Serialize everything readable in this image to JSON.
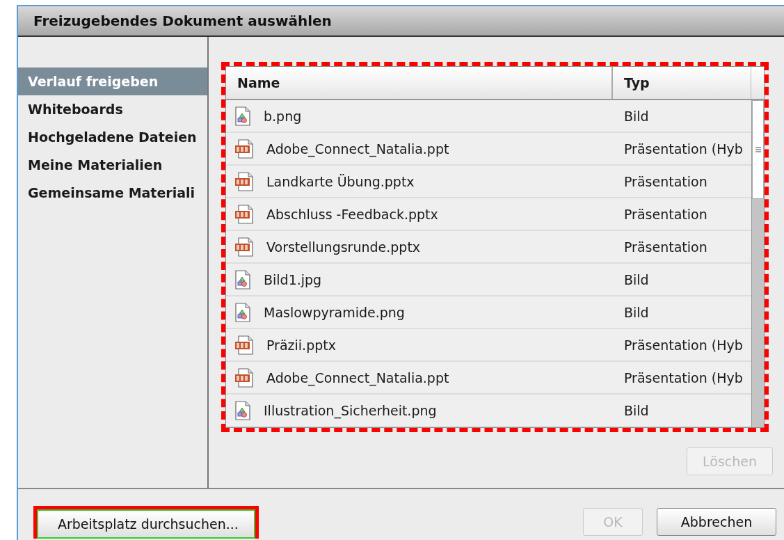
{
  "window": {
    "title": "Freizugebendes Dokument auswählen"
  },
  "sidebar": {
    "items": [
      {
        "label": "Verlauf freigeben",
        "selected": true
      },
      {
        "label": "Whiteboards",
        "selected": false
      },
      {
        "label": "Hochgeladene Dateien",
        "selected": false
      },
      {
        "label": "Meine Materialien",
        "selected": false
      },
      {
        "label": "Gemeinsame Materiali",
        "selected": false
      }
    ]
  },
  "table": {
    "highlighted": true,
    "columns": [
      "Name",
      "Typ"
    ],
    "rows": [
      {
        "kind": "image",
        "name": "b.png",
        "type": "Bild"
      },
      {
        "kind": "presentation",
        "name": "Adobe_Connect_Natalia.ppt",
        "type": "Präsentation (Hyb"
      },
      {
        "kind": "presentation",
        "name": "Landkarte Übung.pptx",
        "type": "Präsentation"
      },
      {
        "kind": "presentation",
        "name": "Abschluss -Feedback.pptx",
        "type": "Präsentation"
      },
      {
        "kind": "presentation",
        "name": "Vorstellungsrunde.pptx",
        "type": "Präsentation"
      },
      {
        "kind": "image",
        "name": "Bild1.jpg",
        "type": "Bild"
      },
      {
        "kind": "image",
        "name": "Maslowpyramide.png",
        "type": "Bild"
      },
      {
        "kind": "presentation",
        "name": "Präzii.pptx",
        "type": "Präsentation (Hyb"
      },
      {
        "kind": "presentation",
        "name": "Adobe_Connect_Natalia.ppt",
        "type": "Präsentation (Hyb"
      },
      {
        "kind": "image",
        "name": "Illustration_Sicherheit.png",
        "type": "Bild"
      }
    ]
  },
  "delete_button": {
    "label": "Löschen",
    "disabled": true
  },
  "browse_button": {
    "label": "Arbeitsplatz durchsuchen...",
    "highlighted": true
  },
  "ok_button": {
    "label": "OK",
    "disabled": true
  },
  "cancel_button": {
    "label": "Abbrechen",
    "disabled": false
  }
}
